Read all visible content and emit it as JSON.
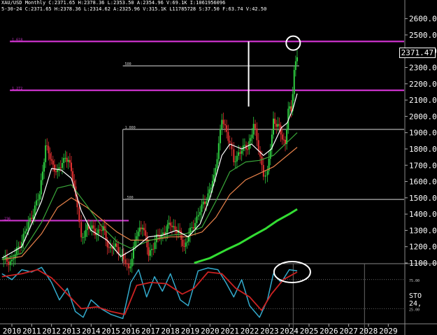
{
  "header": {
    "line1": "XAU/USD Monthly  C:2371.65  H:2378.36  L:2353.50  A:2354.96  V:69.1K  I:1061956096",
    "line2": "5-30-24  C:2371.65  H:2378.36  L:2314.62  A:2325.96  V:315.1K  L11785728  S:37.50  F:63.74  V:42.50"
  },
  "current_price": "2371.47",
  "indicator_label": "STO  24,",
  "colors": {
    "background": "#000000",
    "up_candle": "#2ecc40",
    "down_candle": "#e03030",
    "ma_white": "#ffffff",
    "ma_green": "#3aa83a",
    "ma_orange": "#e8824a",
    "ma_long_green": "#33dd33",
    "fib_magenta": "#cc33cc",
    "stoch_cyan": "#33aacc",
    "stoch_red": "#cc2222"
  },
  "chart_data": {
    "type": "line",
    "x_range": [
      2009.4,
      2029.8
    ],
    "ylim": [
      1100,
      2650
    ],
    "y_ticks": [
      "1100.00",
      "1200.00",
      "1300.00",
      "1400.00",
      "1500.00",
      "1600.00",
      "1700.00",
      "1800.00",
      "1900.00",
      "2000.00",
      "2100.00",
      "2200.00",
      "2300.00",
      "2400.00",
      "2500.00",
      "2600.00"
    ],
    "y_tick_values": [
      1100,
      1200,
      1300,
      1400,
      1500,
      1600,
      1700,
      1800,
      1900,
      2000,
      2100,
      2200,
      2300,
      2400,
      2500,
      2600
    ],
    "x_ticks": [
      "2010",
      "2011",
      "2012",
      "2013",
      "2014",
      "2015",
      "2016",
      "2017",
      "2018",
      "2019",
      "2020",
      "2021",
      "2022",
      "2023",
      "2024",
      "2025",
      "2026",
      "2027",
      "2028",
      "2029"
    ],
    "x_tick_values": [
      2010,
      2011,
      2012,
      2013,
      2014,
      2015,
      2016,
      2017,
      2018,
      2019,
      2020,
      2021,
      2022,
      2023,
      2024,
      2025,
      2026,
      2027,
      2028,
      2029
    ],
    "price_path": [
      [
        2009.5,
        1120
      ],
      [
        2010.0,
        1110
      ],
      [
        2010.5,
        1240
      ],
      [
        2011.0,
        1390
      ],
      [
        2011.4,
        1520
      ],
      [
        2011.7,
        1820
      ],
      [
        2012.0,
        1720
      ],
      [
        2012.3,
        1650
      ],
      [
        2012.7,
        1760
      ],
      [
        2013.0,
        1670
      ],
      [
        2013.3,
        1460
      ],
      [
        2013.5,
        1230
      ],
      [
        2013.8,
        1330
      ],
      [
        2014.2,
        1290
      ],
      [
        2014.6,
        1310
      ],
      [
        2014.9,
        1190
      ],
      [
        2015.3,
        1200
      ],
      [
        2015.9,
        1060
      ],
      [
        2016.3,
        1270
      ],
      [
        2016.6,
        1340
      ],
      [
        2016.9,
        1150
      ],
      [
        2017.3,
        1250
      ],
      [
        2017.7,
        1290
      ],
      [
        2018.0,
        1340
      ],
      [
        2018.4,
        1290
      ],
      [
        2018.7,
        1200
      ],
      [
        2019.0,
        1290
      ],
      [
        2019.5,
        1420
      ],
      [
        2019.9,
        1520
      ],
      [
        2020.2,
        1620
      ],
      [
        2020.6,
        1980
      ],
      [
        2021.0,
        1850
      ],
      [
        2021.2,
        1710
      ],
      [
        2021.6,
        1810
      ],
      [
        2021.9,
        1800
      ],
      [
        2022.2,
        1950
      ],
      [
        2022.7,
        1650
      ],
      [
        2022.9,
        1640
      ],
      [
        2023.2,
        1980
      ],
      [
        2023.5,
        1920
      ],
      [
        2023.8,
        1830
      ],
      [
        2023.95,
        2040
      ],
      [
        2024.1,
        2030
      ],
      [
        2024.25,
        2290
      ],
      [
        2024.4,
        2370
      ]
    ],
    "ma_short": [
      [
        2009.5,
        1130
      ],
      [
        2010.5,
        1200
      ],
      [
        2011.5,
        1480
      ],
      [
        2012.0,
        1680
      ],
      [
        2012.5,
        1670
      ],
      [
        2013.0,
        1620
      ],
      [
        2013.5,
        1420
      ],
      [
        2014.0,
        1300
      ],
      [
        2014.8,
        1240
      ],
      [
        2015.5,
        1140
      ],
      [
        2016.2,
        1190
      ],
      [
        2016.9,
        1260
      ],
      [
        2017.6,
        1270
      ],
      [
        2018.3,
        1300
      ],
      [
        2018.9,
        1260
      ],
      [
        2019.5,
        1340
      ],
      [
        2020.0,
        1500
      ],
      [
        2020.6,
        1760
      ],
      [
        2021.0,
        1830
      ],
      [
        2021.6,
        1800
      ],
      [
        2022.1,
        1830
      ],
      [
        2022.7,
        1760
      ],
      [
        2023.1,
        1800
      ],
      [
        2023.6,
        1930
      ],
      [
        2023.9,
        1960
      ],
      [
        2024.2,
        2050
      ],
      [
        2024.4,
        2140
      ]
    ],
    "ma_mid": [
      [
        2009.5,
        1120
      ],
      [
        2010.5,
        1160
      ],
      [
        2011.5,
        1350
      ],
      [
        2012.3,
        1560
      ],
      [
        2013.0,
        1580
      ],
      [
        2013.8,
        1450
      ],
      [
        2014.5,
        1330
      ],
      [
        2015.3,
        1230
      ],
      [
        2016.0,
        1190
      ],
      [
        2017.0,
        1240
      ],
      [
        2018.0,
        1270
      ],
      [
        2018.8,
        1280
      ],
      [
        2019.6,
        1320
      ],
      [
        2020.3,
        1480
      ],
      [
        2021.0,
        1660
      ],
      [
        2021.8,
        1720
      ],
      [
        2022.5,
        1730
      ],
      [
        2023.2,
        1760
      ],
      [
        2023.8,
        1830
      ],
      [
        2024.4,
        1900
      ]
    ],
    "ma_orange": [
      [
        2009.5,
        1120
      ],
      [
        2010.5,
        1140
      ],
      [
        2011.5,
        1280
      ],
      [
        2012.3,
        1440
      ],
      [
        2013.0,
        1500
      ],
      [
        2013.8,
        1440
      ],
      [
        2014.5,
        1370
      ],
      [
        2015.3,
        1290
      ],
      [
        2016.0,
        1240
      ],
      [
        2017.0,
        1240
      ],
      [
        2018.0,
        1260
      ],
      [
        2018.8,
        1260
      ],
      [
        2019.6,
        1290
      ],
      [
        2020.3,
        1380
      ],
      [
        2021.0,
        1520
      ],
      [
        2021.8,
        1610
      ],
      [
        2022.5,
        1650
      ],
      [
        2023.2,
        1690
      ],
      [
        2023.8,
        1750
      ],
      [
        2024.4,
        1810
      ]
    ],
    "ma_long": [
      [
        2019.2,
        1100
      ],
      [
        2020.0,
        1130
      ],
      [
        2020.8,
        1180
      ],
      [
        2021.5,
        1220
      ],
      [
        2022.2,
        1270
      ],
      [
        2022.8,
        1310
      ],
      [
        2023.4,
        1360
      ],
      [
        2024.0,
        1400
      ],
      [
        2024.4,
        1430
      ]
    ],
    "horizontal_lines": [
      {
        "label": "1.618",
        "y": 2460,
        "x_start": 2009.9,
        "x_end": 2029.8,
        "color": "magenta"
      },
      {
        "label": "500",
        "y": 2310,
        "x_start": 2015.6,
        "x_end": 2024.5,
        "color": "white"
      },
      {
        "label": "1.272",
        "y": 2160,
        "x_start": 2009.9,
        "x_end": 2029.8,
        "color": "magenta"
      },
      {
        "label": "1.000",
        "y": 1920,
        "x_start": 2015.6,
        "x_end": 2029.8,
        "color": "white"
      },
      {
        "label": ".500",
        "y": 1490,
        "x_start": 2015.6,
        "x_end": 2029.8,
        "color": "white"
      },
      {
        "label": ".236",
        "y": 1360,
        "x_start": 2009.4,
        "x_end": 2015.9,
        "color": "magenta"
      }
    ],
    "stoch": {
      "fast": [
        [
          2009.5,
          85
        ],
        [
          2010.0,
          75
        ],
        [
          2010.5,
          92
        ],
        [
          2011.0,
          88
        ],
        [
          2011.5,
          96
        ],
        [
          2012.0,
          70
        ],
        [
          2012.4,
          40
        ],
        [
          2012.8,
          60
        ],
        [
          2013.2,
          20
        ],
        [
          2013.6,
          10
        ],
        [
          2014.0,
          40
        ],
        [
          2014.5,
          25
        ],
        [
          2015.0,
          15
        ],
        [
          2015.6,
          8
        ],
        [
          2016.0,
          70
        ],
        [
          2016.4,
          92
        ],
        [
          2016.8,
          45
        ],
        [
          2017.2,
          80
        ],
        [
          2017.6,
          55
        ],
        [
          2018.0,
          85
        ],
        [
          2018.5,
          40
        ],
        [
          2018.9,
          30
        ],
        [
          2019.4,
          90
        ],
        [
          2019.9,
          95
        ],
        [
          2020.4,
          92
        ],
        [
          2020.8,
          70
        ],
        [
          2021.2,
          45
        ],
        [
          2021.6,
          75
        ],
        [
          2022.0,
          30
        ],
        [
          2022.5,
          10
        ],
        [
          2022.9,
          40
        ],
        [
          2023.2,
          85
        ],
        [
          2023.6,
          70
        ],
        [
          2024.0,
          92
        ],
        [
          2024.4,
          90
        ]
      ],
      "slow": [
        [
          2009.5,
          80
        ],
        [
          2010.5,
          85
        ],
        [
          2011.3,
          92
        ],
        [
          2012.0,
          78
        ],
        [
          2012.8,
          50
        ],
        [
          2013.5,
          25
        ],
        [
          2014.3,
          28
        ],
        [
          2015.0,
          20
        ],
        [
          2015.7,
          15
        ],
        [
          2016.3,
          65
        ],
        [
          2017.0,
          70
        ],
        [
          2017.8,
          68
        ],
        [
          2018.6,
          50
        ],
        [
          2019.2,
          60
        ],
        [
          2019.9,
          88
        ],
        [
          2020.6,
          85
        ],
        [
          2021.3,
          60
        ],
        [
          2022.0,
          45
        ],
        [
          2022.6,
          22
        ],
        [
          2023.1,
          50
        ],
        [
          2023.7,
          75
        ],
        [
          2024.4,
          88
        ]
      ],
      "levels": [
        75,
        25
      ],
      "level_labels": [
        "75.00",
        "25.00"
      ]
    },
    "annotations": {
      "vertical_line": {
        "x": 2021.95,
        "y_from": 2460,
        "y_to": 2060
      },
      "circle_price": {
        "x": 2024.2,
        "y": 2450
      },
      "circle_stoch": {
        "x": 2024.15,
        "y": 88
      }
    },
    "grid_lines_x": [
      2024.2,
      2027.8
    ],
    "stoch_dotted_levels": [
      75,
      25
    ]
  }
}
